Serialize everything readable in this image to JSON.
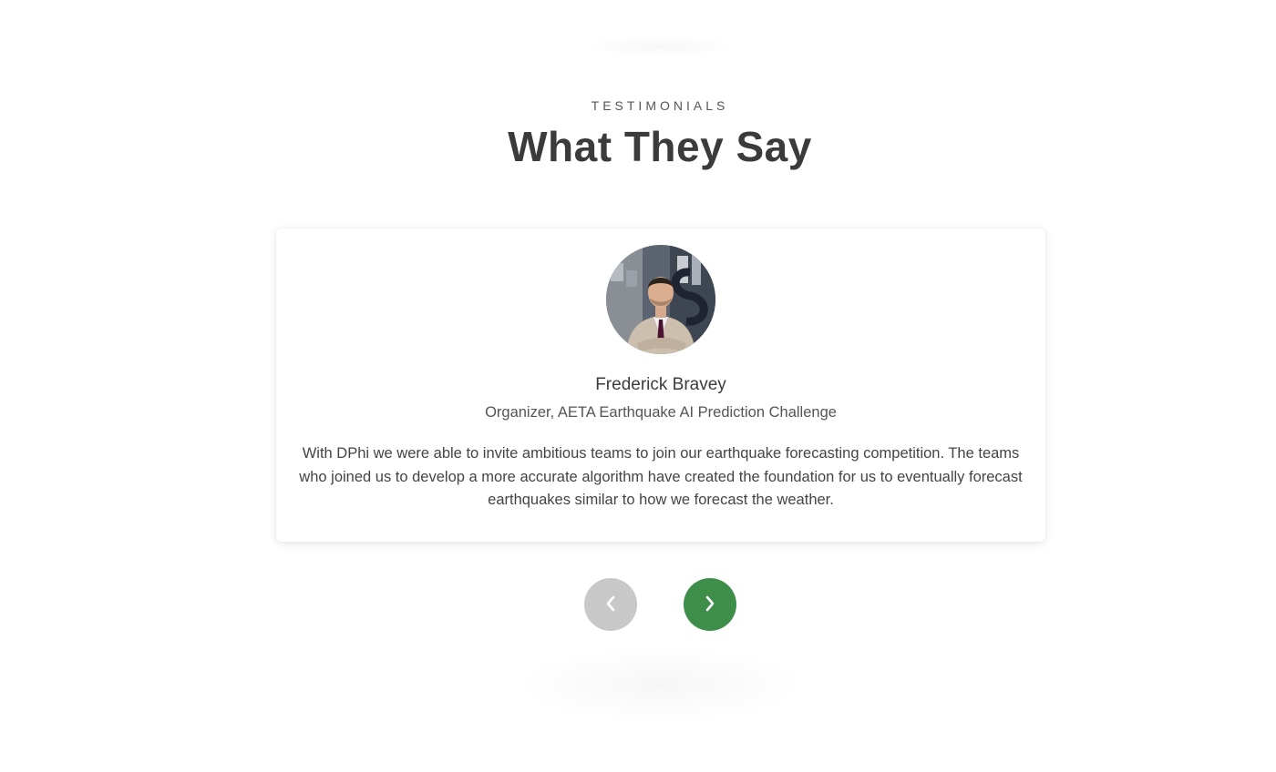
{
  "section": {
    "eyebrow": "TESTIMONIALS",
    "title": "What They Say"
  },
  "testimonial": {
    "name": "Frederick Bravey",
    "role": "Organizer, AETA Earthquake AI Prediction Challenge",
    "quote": "With DPhi we were able to invite ambitious teams to join our earthquake forecasting competition. The teams who joined us to develop a more accurate algorithm have created the foundation for us to eventually forecast earthquakes similar to how we forecast the weather."
  },
  "controls": {
    "prev_icon": "chevron-left-icon",
    "next_icon": "chevron-right-icon"
  },
  "colors": {
    "next_button": "#3e8e4a",
    "prev_button": "#c8c8c8",
    "heading": "#3b3b3b"
  }
}
